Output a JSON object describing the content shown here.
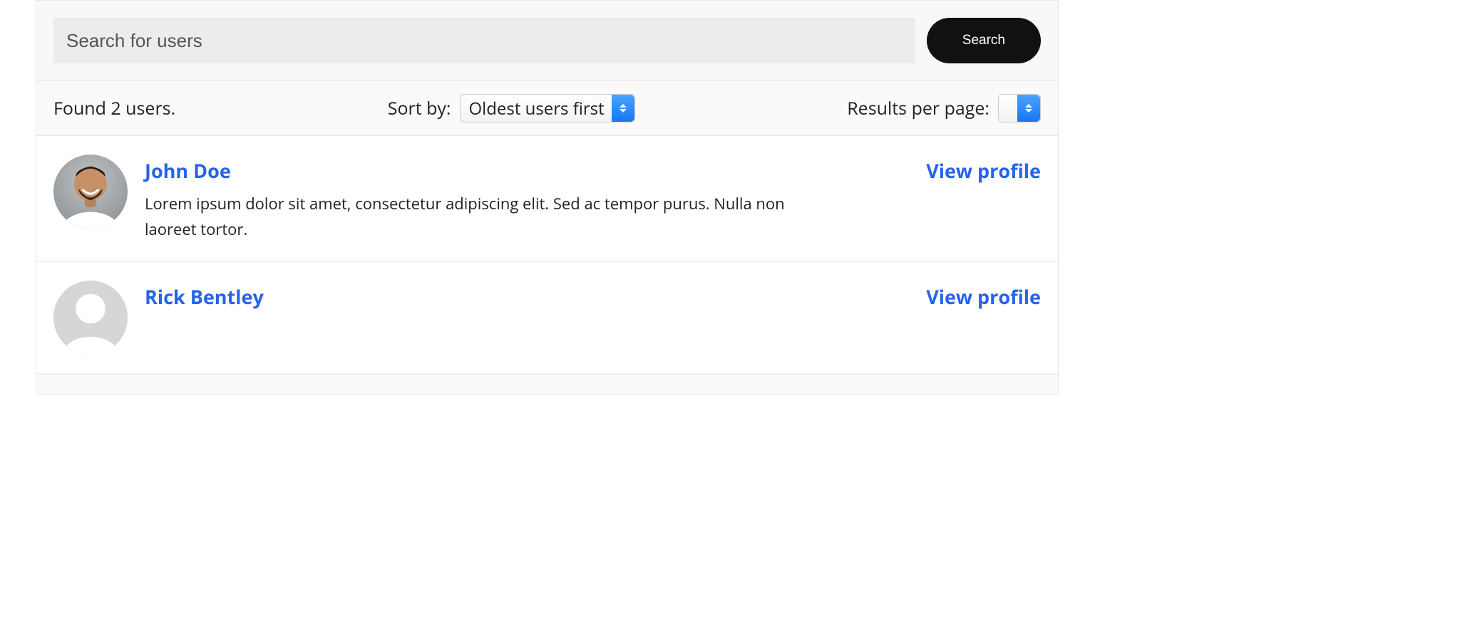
{
  "search": {
    "placeholder": "Search for users",
    "value": "",
    "button_label": "Search"
  },
  "toolbar": {
    "results_count_text": "Found 2 users.",
    "sort_label": "Sort by:",
    "sort_selected": "Oldest users first",
    "perpage_label": "Results per page:",
    "perpage_selected": ""
  },
  "results": [
    {
      "name": "John Doe",
      "bio": "Lorem ipsum dolor sit amet, consectetur adipiscing elit. Sed ac tempor purus. Nulla non laoreet tortor.",
      "action_label": "View profile",
      "avatar_kind": "photo"
    },
    {
      "name": "Rick Bentley",
      "bio": "",
      "action_label": "View profile",
      "avatar_kind": "placeholder"
    }
  ]
}
